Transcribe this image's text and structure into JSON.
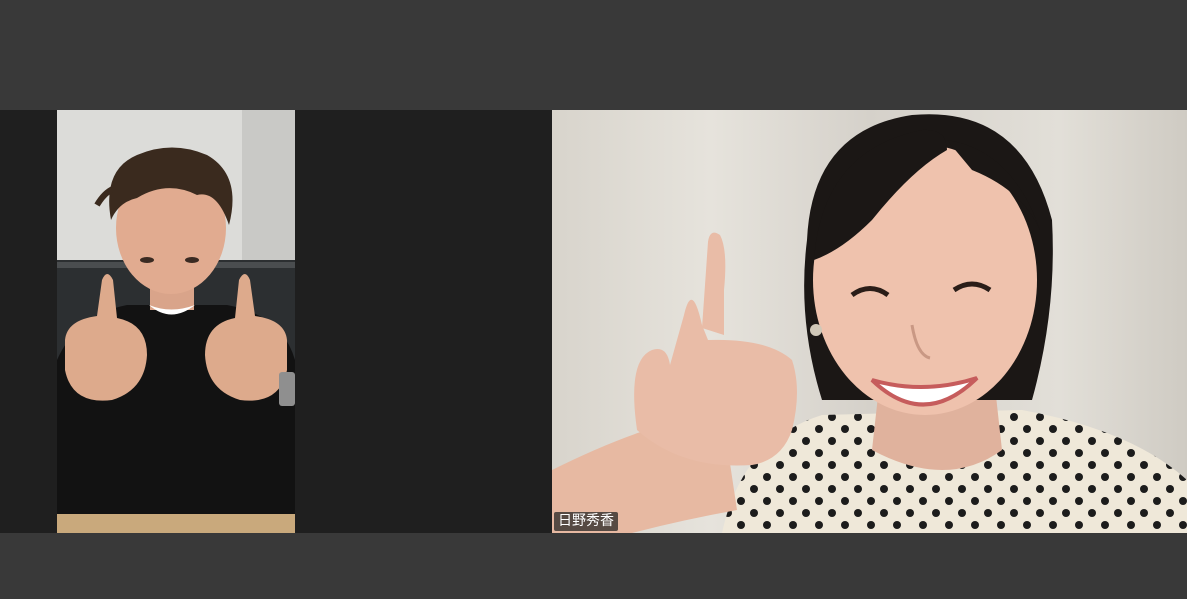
{
  "meeting": {
    "participants": [
      {
        "id": "p1",
        "name": "",
        "video_on": true
      },
      {
        "id": "p2",
        "name": "日野秀香",
        "video_on": true
      }
    ]
  },
  "colors": {
    "toolbar_bg": "#393939",
    "gallery_bg": "#1f1f1f",
    "name_label_bg": "#1e1e1e",
    "name_label_text": "#ffffff"
  }
}
